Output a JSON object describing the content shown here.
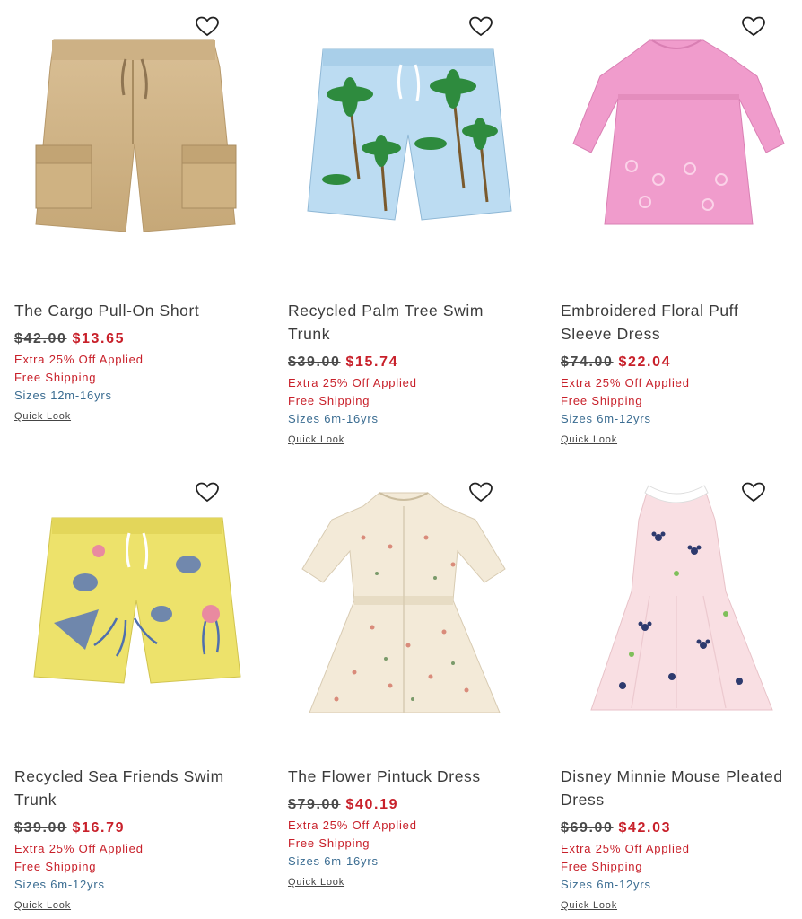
{
  "products": [
    {
      "title": "The Cargo Pull-On Short",
      "was_price": "$42.00",
      "now_price": "$13.65",
      "promo": "Extra 25% Off Applied",
      "shipping": "Free Shipping",
      "sizes": "Sizes 12m-16yrs",
      "quick_look": "Quick Look"
    },
    {
      "title": "Recycled Palm Tree Swim Trunk",
      "was_price": "$39.00",
      "now_price": "$15.74",
      "promo": "Extra 25% Off Applied",
      "shipping": "Free Shipping",
      "sizes": "Sizes 6m-16yrs",
      "quick_look": "Quick Look"
    },
    {
      "title": "Embroidered Floral Puff Sleeve Dress",
      "was_price": "$74.00",
      "now_price": "$22.04",
      "promo": "Extra 25% Off Applied",
      "shipping": "Free Shipping",
      "sizes": "Sizes 6m-12yrs",
      "quick_look": "Quick Look"
    },
    {
      "title": "Recycled Sea Friends Swim Trunk",
      "was_price": "$39.00",
      "now_price": "$16.79",
      "promo": "Extra 25% Off Applied",
      "shipping": "Free Shipping",
      "sizes": "Sizes 6m-12yrs",
      "quick_look": "Quick Look"
    },
    {
      "title": "The Flower Pintuck Dress",
      "was_price": "$79.00",
      "now_price": "$40.19",
      "promo": "Extra 25% Off Applied",
      "shipping": "Free Shipping",
      "sizes": "Sizes 6m-16yrs",
      "quick_look": "Quick Look"
    },
    {
      "title": "Disney Minnie Mouse Pleated Dress",
      "was_price": "$69.00",
      "now_price": "$42.03",
      "promo": "Extra 25% Off Applied",
      "shipping": "Free Shipping",
      "sizes": "Sizes 6m-12yrs",
      "quick_look": "Quick Look"
    }
  ],
  "colors": {
    "sale_red": "#c8202a",
    "sizes_blue": "#3a6c91",
    "title_gray": "#3b3b3b"
  }
}
